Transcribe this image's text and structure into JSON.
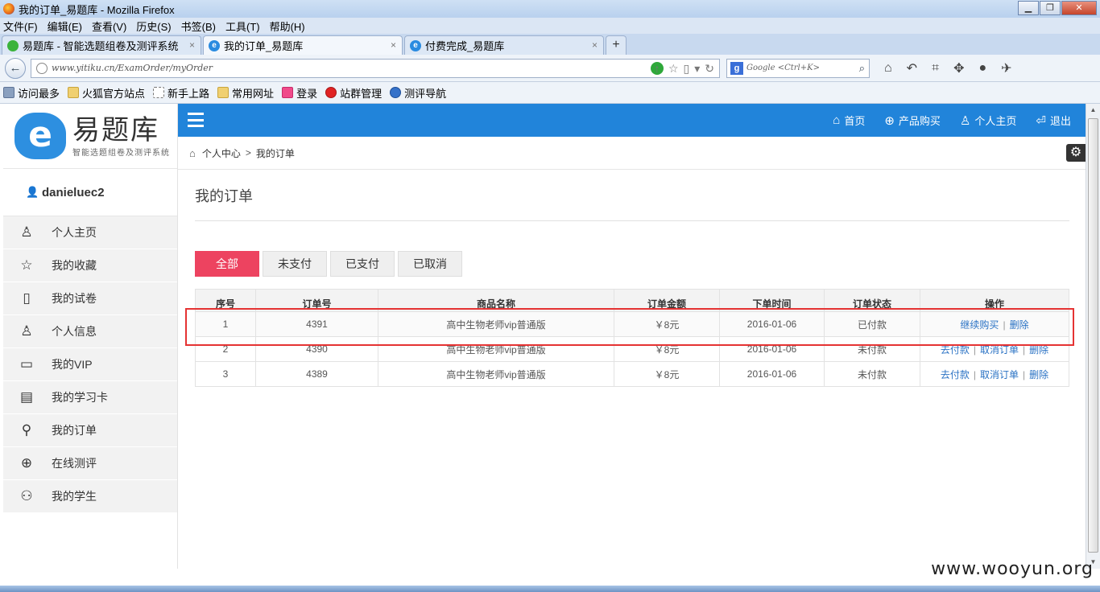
{
  "window": {
    "title": "我的订单_易题库 - Mozilla Firefox",
    "minimize": "▁",
    "maximize": "❐",
    "close": "✕"
  },
  "menubar": [
    "文件(F)",
    "编辑(E)",
    "查看(V)",
    "历史(S)",
    "书签(B)",
    "工具(T)",
    "帮助(H)"
  ],
  "tabs": [
    {
      "label": "易题库 - 智能选题组卷及测评系统",
      "active": false
    },
    {
      "label": "我的订单_易题库",
      "active": true
    },
    {
      "label": "付费完成_易题库",
      "active": false
    }
  ],
  "tab_close": "×",
  "tab_new": "+",
  "address": {
    "url": "www.yitiku.cn/ExamOrder/myOrder",
    "search_placeholder": "Google <Ctrl+K>"
  },
  "bookmarks": [
    "访问最多",
    "火狐官方站点",
    "新手上路",
    "常用网址",
    "登录",
    "站群管理",
    "测评导航"
  ],
  "site": {
    "logo_letter": "e",
    "logo_name": "易题库",
    "logo_sub": "智能选题组卷及测评系统",
    "username": "danieluec2",
    "side_menu": [
      {
        "label": "个人主页",
        "icon": "user-icon"
      },
      {
        "label": "我的收藏",
        "icon": "star-icon"
      },
      {
        "label": "我的试卷",
        "icon": "paper-icon"
      },
      {
        "label": "个人信息",
        "icon": "profile-icon"
      },
      {
        "label": "我的VIP",
        "icon": "vip-icon"
      },
      {
        "label": "我的学习卡",
        "icon": "card-icon"
      },
      {
        "label": "我的订单",
        "icon": "search-icon"
      },
      {
        "label": "在线测评",
        "icon": "globe-icon"
      },
      {
        "label": "我的学生",
        "icon": "users-icon"
      }
    ],
    "top_links": [
      {
        "label": "首页",
        "icon": "home-icon"
      },
      {
        "label": "产品购买",
        "icon": "plus-circle-icon"
      },
      {
        "label": "个人主页",
        "icon": "user-icon"
      },
      {
        "label": "退出",
        "icon": "logout-icon"
      }
    ],
    "breadcrumb": [
      "个人中心",
      "我的订单"
    ],
    "breadcrumb_sep": ">"
  },
  "main": {
    "title": "我的订单",
    "filters": [
      "全部",
      "未支付",
      "已支付",
      "已取消"
    ],
    "active_filter": 0,
    "columns": [
      "序号",
      "订单号",
      "商品名称",
      "订单金额",
      "下单时间",
      "订单状态",
      "操作"
    ],
    "rows": [
      {
        "no": "1",
        "order_id": "4391",
        "product": "高中生物老师vip普通版",
        "amount": "￥8元",
        "date": "2016-01-06",
        "status": "已付款",
        "actions": [
          "继续购买",
          "删除"
        ]
      },
      {
        "no": "2",
        "order_id": "4390",
        "product": "高中生物老师vip普通版",
        "amount": "￥8元",
        "date": "2016-01-06",
        "status": "未付款",
        "actions": [
          "去付款",
          "取消订单",
          "删除"
        ]
      },
      {
        "no": "3",
        "order_id": "4389",
        "product": "高中生物老师vip普通版",
        "amount": "￥8元",
        "date": "2016-01-06",
        "status": "未付款",
        "actions": [
          "去付款",
          "取消订单",
          "删除"
        ]
      }
    ]
  },
  "watermark": "www.wooyun.org",
  "colors": {
    "nav_blue": "#2184da",
    "filter_active": "#ed4360",
    "highlight_red": "#e53333",
    "link_blue": "#2a72c4"
  }
}
